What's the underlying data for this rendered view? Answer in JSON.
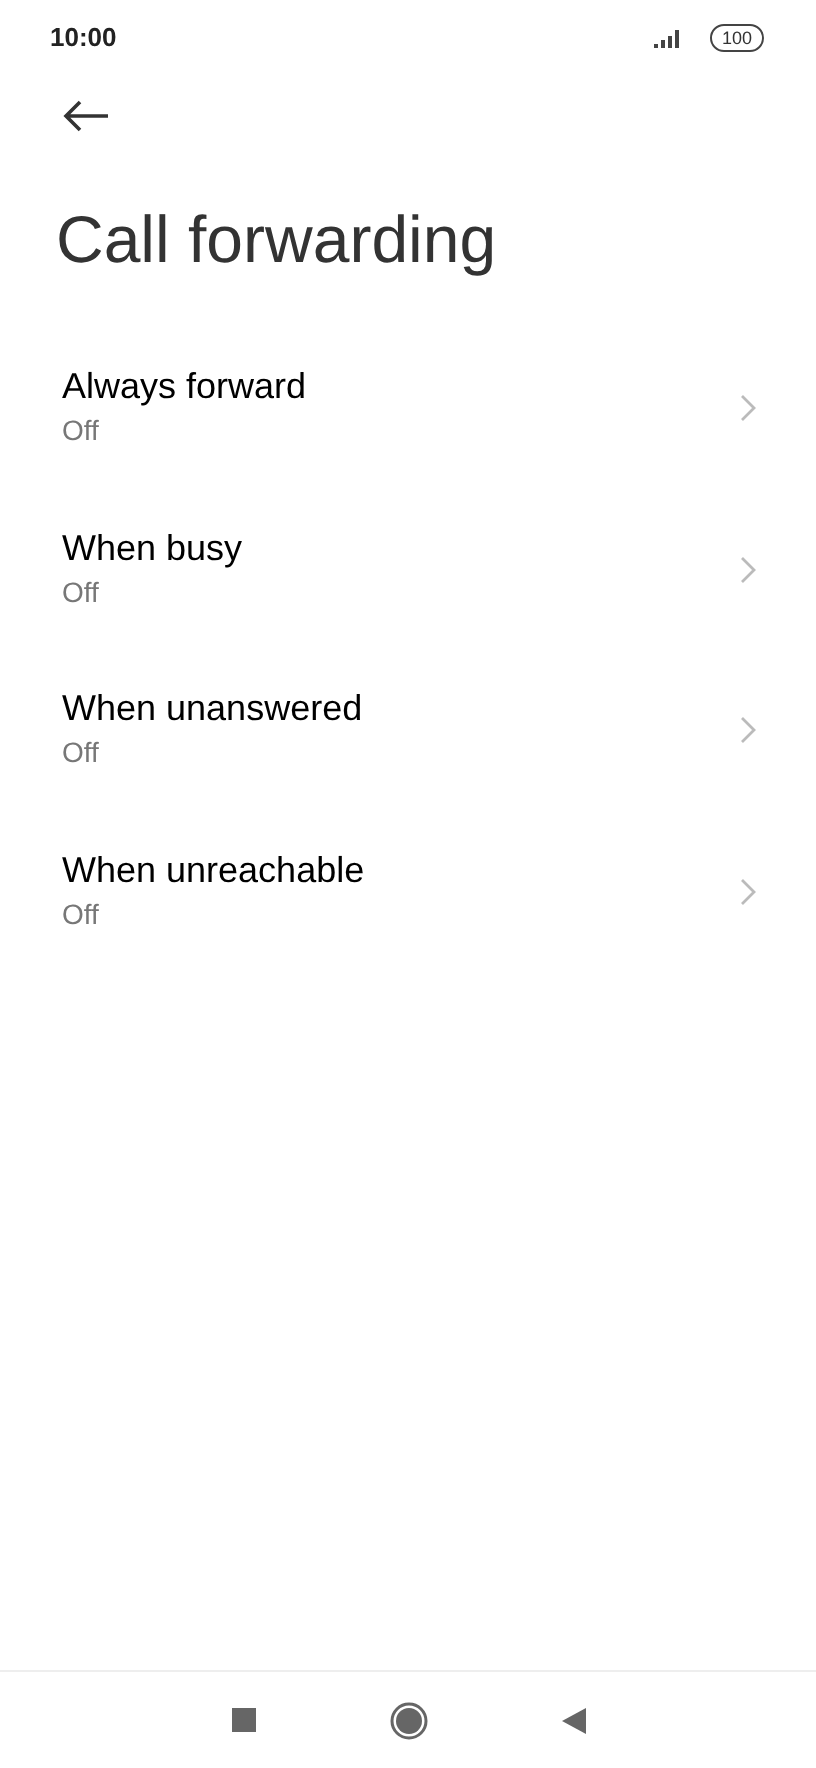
{
  "status_bar": {
    "time": "10:00",
    "battery": "100"
  },
  "title": "Call forwarding",
  "items": [
    {
      "label": "Always forward",
      "value": "Off"
    },
    {
      "label": "When busy",
      "value": "Off"
    },
    {
      "label": "When unanswered",
      "value": "Off"
    },
    {
      "label": "When unreachable",
      "value": "Off"
    }
  ]
}
